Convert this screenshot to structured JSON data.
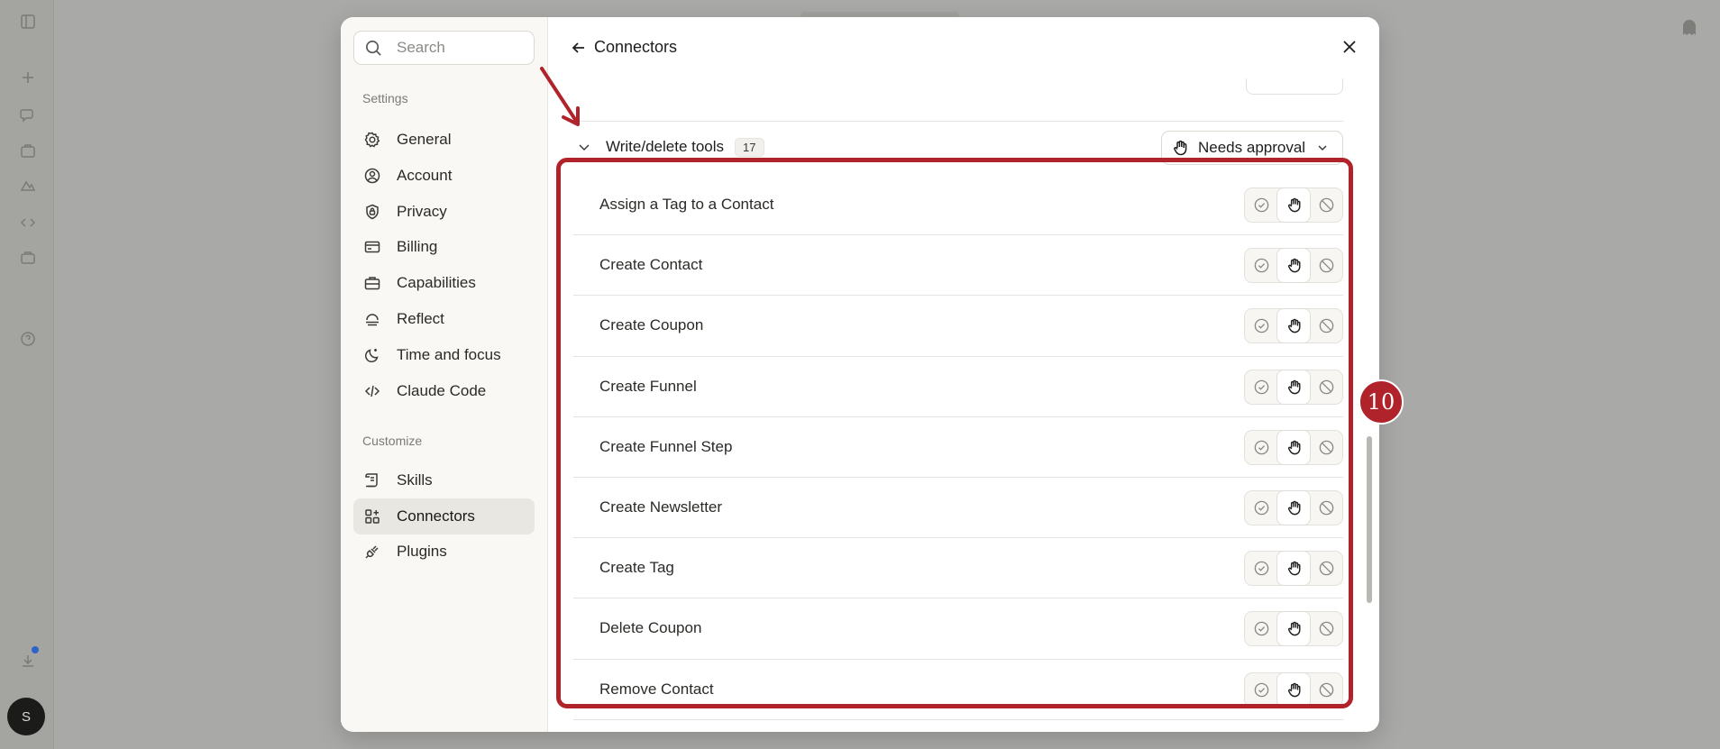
{
  "sidebar": {
    "search_placeholder": "Search",
    "settings_label": "Settings",
    "settings_items": [
      {
        "label": "General",
        "icon": "gear-icon"
      },
      {
        "label": "Account",
        "icon": "user-circle-icon"
      },
      {
        "label": "Privacy",
        "icon": "shield-icon"
      },
      {
        "label": "Billing",
        "icon": "credit-card-icon"
      },
      {
        "label": "Capabilities",
        "icon": "briefcase-icon"
      },
      {
        "label": "Reflect",
        "icon": "reflect-icon"
      },
      {
        "label": "Time and focus",
        "icon": "moon-icon"
      },
      {
        "label": "Claude Code",
        "icon": "code-icon"
      }
    ],
    "customize_label": "Customize",
    "customize_items": [
      {
        "label": "Skills",
        "icon": "scroll-icon"
      },
      {
        "label": "Connectors",
        "icon": "grid-plus-icon",
        "active": true
      },
      {
        "label": "Plugins",
        "icon": "plug-icon"
      }
    ]
  },
  "header": {
    "title": "Connectors"
  },
  "group": {
    "title": "Write/delete tools",
    "count": "17",
    "approval_label": "Needs approval"
  },
  "tools": [
    {
      "name": "Assign a Tag to a Contact",
      "permission": "needs-approval"
    },
    {
      "name": "Create Contact",
      "permission": "needs-approval"
    },
    {
      "name": "Create Coupon",
      "permission": "needs-approval"
    },
    {
      "name": "Create Funnel",
      "permission": "needs-approval"
    },
    {
      "name": "Create Funnel Step",
      "permission": "needs-approval"
    },
    {
      "name": "Create Newsletter",
      "permission": "needs-approval"
    },
    {
      "name": "Create Tag",
      "permission": "needs-approval"
    },
    {
      "name": "Delete Coupon",
      "permission": "needs-approval"
    },
    {
      "name": "Remove Contact",
      "permission": "needs-approval"
    }
  ],
  "annotation": {
    "step_number": "10",
    "color": "#b0232a"
  },
  "user": {
    "avatar_initial": "S"
  },
  "colors": {
    "accent": "#b0232a",
    "active_nav": "#e9e7e1"
  }
}
